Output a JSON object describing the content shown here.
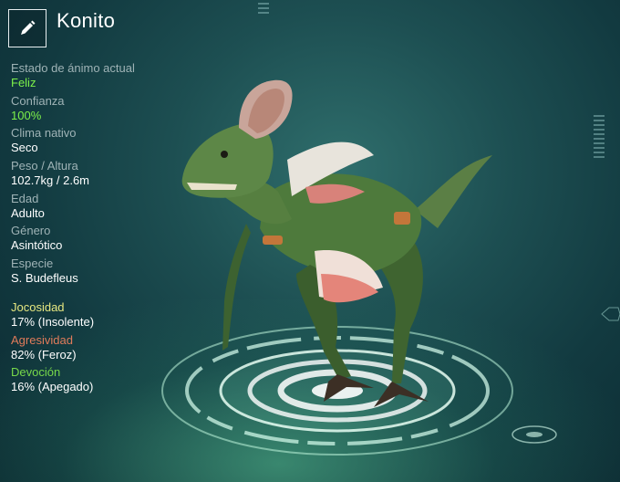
{
  "creature": {
    "name": "Konito"
  },
  "stats": [
    {
      "label": "Estado de ánimo actual",
      "value": "Feliz"
    },
    {
      "label": "Confianza",
      "value": "100%"
    },
    {
      "label": "Clima nativo",
      "value": "Seco"
    },
    {
      "label": "Peso / Altura",
      "value": "102.7kg / 2.6m"
    },
    {
      "label": "Edad",
      "value": "Adulto"
    },
    {
      "label": "Género",
      "value": "Asintótico"
    },
    {
      "label": "Especie",
      "value": "S. Budefleus"
    }
  ],
  "traits": [
    {
      "label": "Jocosidad",
      "value": "17% (Insolente)"
    },
    {
      "label": "Agresividad",
      "value": "82% (Feroz)"
    },
    {
      "label": "Devoción",
      "value": "16% (Apegado)"
    }
  ],
  "colors": {
    "positive": "#7cf04a",
    "jocosidad": "#e6e780",
    "agresividad": "#e07b5a",
    "devocion": "#77d84a",
    "creature_body": "#4e7a3c"
  },
  "icons": {
    "edit": "pencil-icon"
  }
}
